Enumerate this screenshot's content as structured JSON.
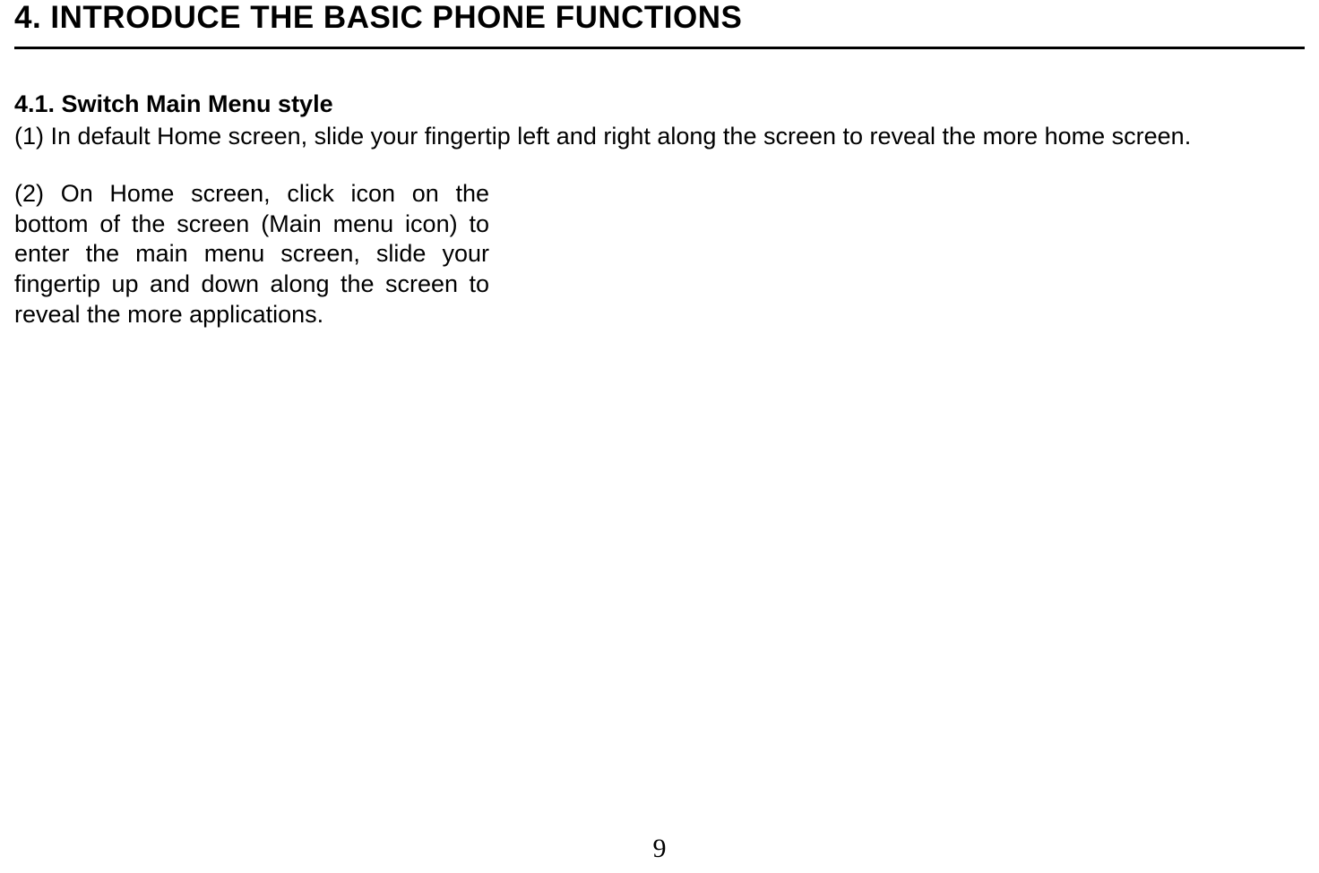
{
  "chapter": {
    "title": "4.    INTRODUCE THE BASIC PHONE FUNCTIONS"
  },
  "section": {
    "title": "4.1. Switch Main Menu style",
    "para1": "(1) In default Home screen, slide your fingertip left and right along the screen to reveal the more home screen.",
    "para2": "(2) On Home screen, click icon on the bottom of the screen (Main menu icon) to enter the main menu screen, slide your fingertip up and down along the screen to reveal the more applications."
  },
  "page_number": "9"
}
